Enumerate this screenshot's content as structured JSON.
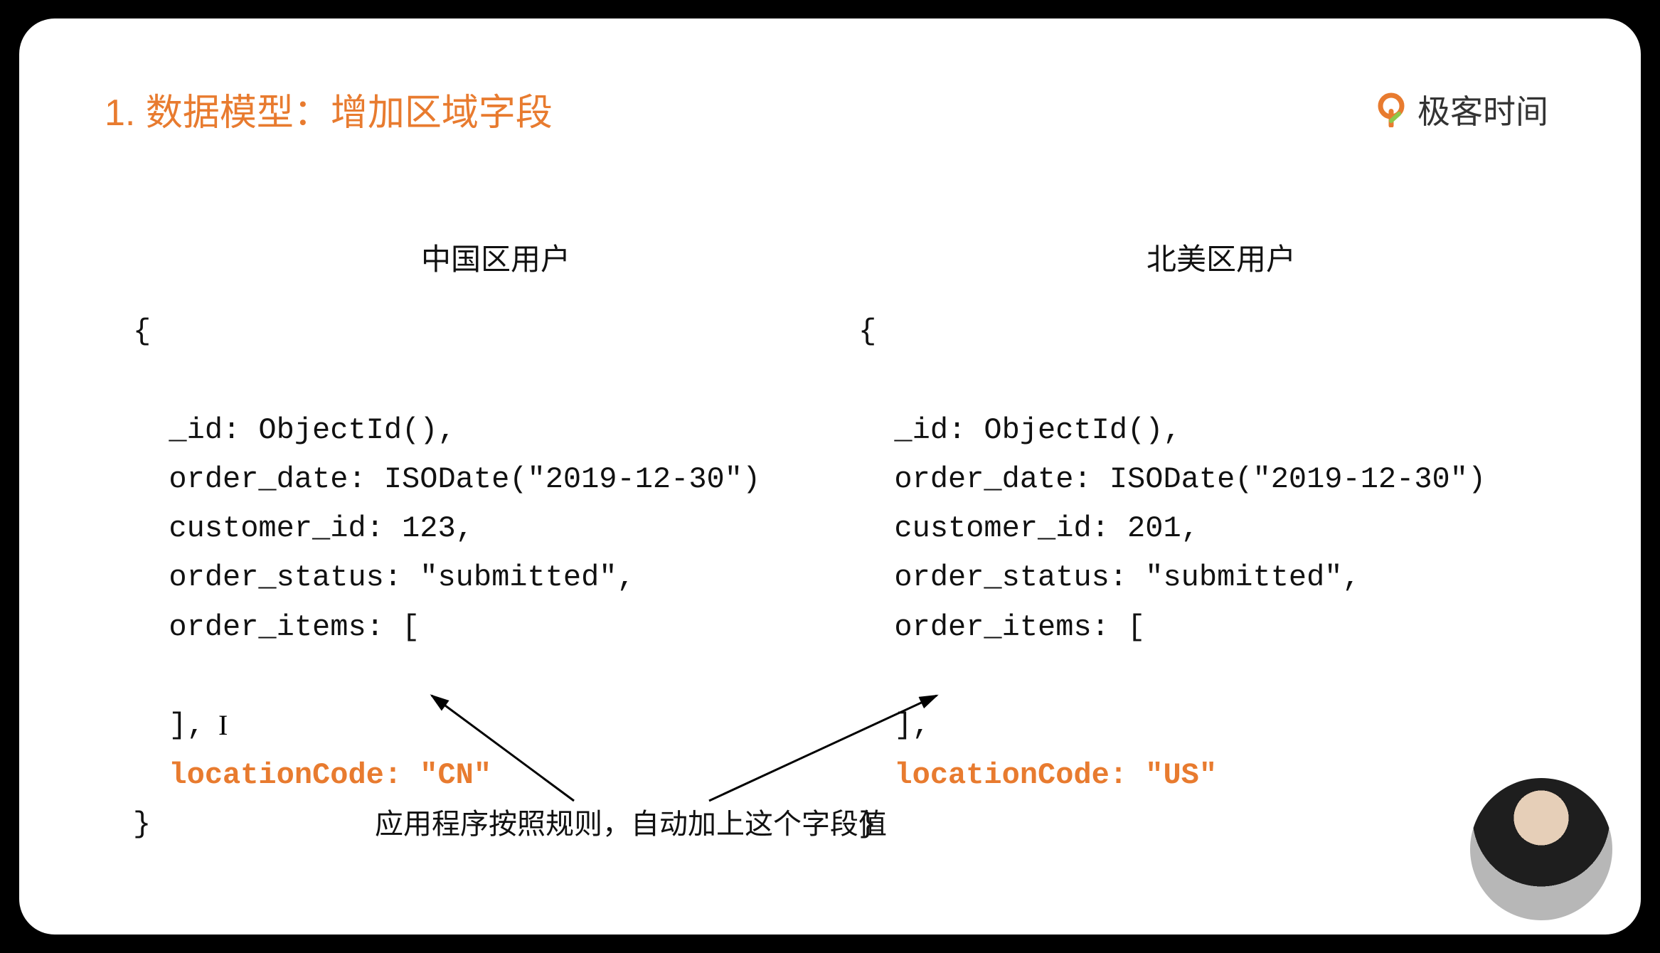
{
  "title": "1. 数据模型：增加区域字段",
  "brand": "极客时间",
  "left": {
    "heading": "中国区用户",
    "lines": {
      "l1": "{",
      "l2": "",
      "l3": "  _id: ObjectId(),",
      "l4": "  order_date: ISODate(\"2019-12-30\")",
      "l5": "  customer_id: 123,",
      "l6": "  order_status: \"submitted\",",
      "l7": "  order_items: [",
      "l8": "",
      "l9": "  ],",
      "l10": "  locationCode: \"CN\"",
      "l11": "}"
    }
  },
  "right": {
    "heading": "北美区用户",
    "lines": {
      "l1": "{",
      "l2": "",
      "l3": "  _id: ObjectId(),",
      "l4": "  order_date: ISODate(\"2019-12-30\")",
      "l5": "  customer_id: 201,",
      "l6": "  order_status: \"submitted\",",
      "l7": "  order_items: [",
      "l8": "",
      "l9": "  ],",
      "l10": "  locationCode: \"US\"",
      "l11": "}"
    }
  },
  "caption": "应用程序按照规则，自动加上这个字段值"
}
